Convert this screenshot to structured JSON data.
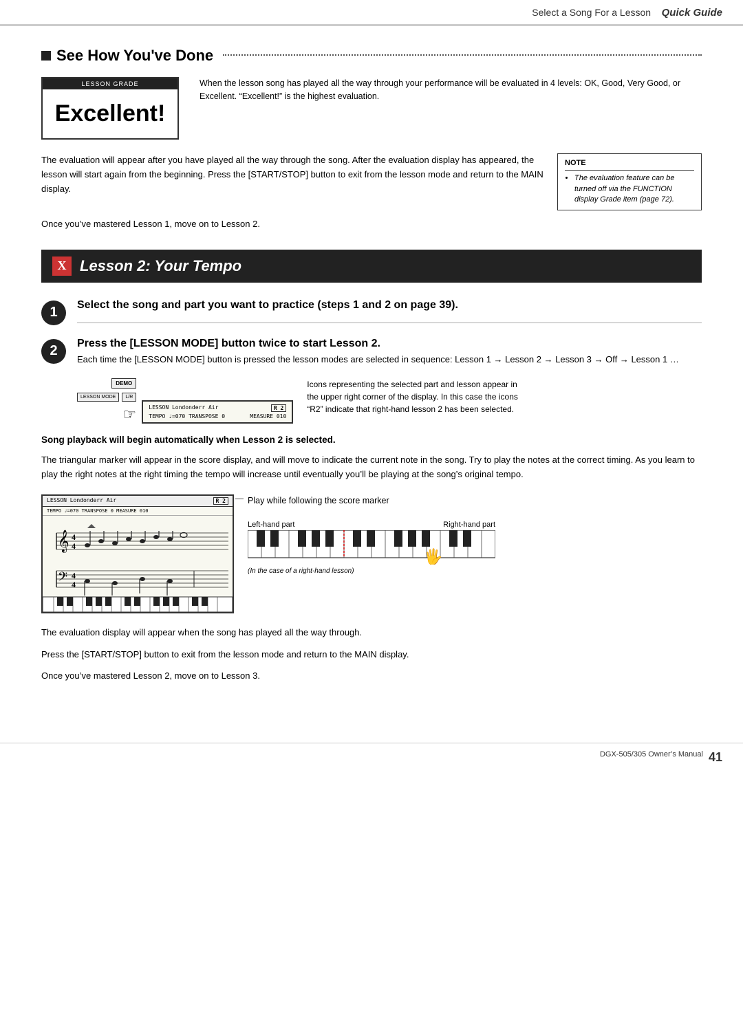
{
  "header": {
    "title": "Select a Song For a Lesson",
    "quick_guide": "Quick Guide"
  },
  "section1": {
    "heading": "See How You've Done",
    "lesson_grade_label": "LESSON GRADE",
    "excellent_text": "Excellent!",
    "excellent_description": "When the lesson song has played all the way through your performance will be evaluated in 4 levels: OK, Good, Very Good, or Excellent. “Excellent!” is the highest evaluation.",
    "body_text1": "The evaluation will appear after you have played all the way through the song. After the evaluation display has appeared, the lesson will start again from the beginning. Press the [START/STOP] button to exit from the lesson mode and return to the MAIN display.",
    "note_header": "NOTE",
    "note_text": "The evaluation feature can be turned off via the FUNCTION display Grade item (page 72).",
    "mastered_text": "Once you’ve mastered Lesson 1, move on to Lesson 2."
  },
  "section2": {
    "x_label": "X",
    "heading": "Lesson 2: Your Tempo",
    "step1": {
      "number": "1",
      "title": "Select the song and part you want to practice (steps 1 and 2 on page 39)."
    },
    "step2": {
      "number": "2",
      "title": "Press the [LESSON MODE] button twice to start Lesson 2.",
      "desc": "Each time the [LESSON MODE] button is pressed the lesson modes are selected in sequence: Lesson 1 → Lesson 2 → Lesson 3 → Off → Lesson 1 …",
      "display_line1_left": "LESSON  Londonderr Air",
      "display_line1_right": "R 2",
      "display_line2_left": "TEMPO ♩=070    TRANSPOSE   0",
      "display_line2_right": "MEASURE 010",
      "btn_demo": "DEMO",
      "btn_lesson": "LESSON MODE",
      "btn_lr": "L/R",
      "display_note": "Icons representing the selected part and lesson appear in the upper right corner of the display. In this case the icons “R2” indicate that right-hand lesson 2 has been selected."
    },
    "playback_bold": "Song playback will begin automatically when Lesson 2 is selected.",
    "body_text2": "The triangular marker will appear in the score display, and will move to indicate the current note in the song. Try to play the notes at the correct timing. As you learn to play the right notes at the right timing the tempo will increase until eventually you’ll be playing at the song’s original tempo.",
    "score_header_left": "LESSON  Londonderr Air",
    "score_header_right": "R 2",
    "score_tempo": "TEMPO ♩=070    TRANSPOSE   0    MEASURE 010",
    "play_annotation": "Play while following the score marker",
    "left_hand_label": "Left-hand part",
    "right_hand_label": "Right-hand part",
    "in_case_text": "(In the case of a right-hand lesson)",
    "body_text3": "The evaluation display will appear when the song has played all the way through.",
    "body_text4": "Press the [START/STOP] button to exit from the lesson mode and return to the MAIN display.",
    "mastered_text2": "Once you’ve mastered Lesson 2, move on to Lesson 3."
  },
  "footer": {
    "manual_text": "DGX-505/305  Owner’s Manual",
    "page_number": "41"
  }
}
